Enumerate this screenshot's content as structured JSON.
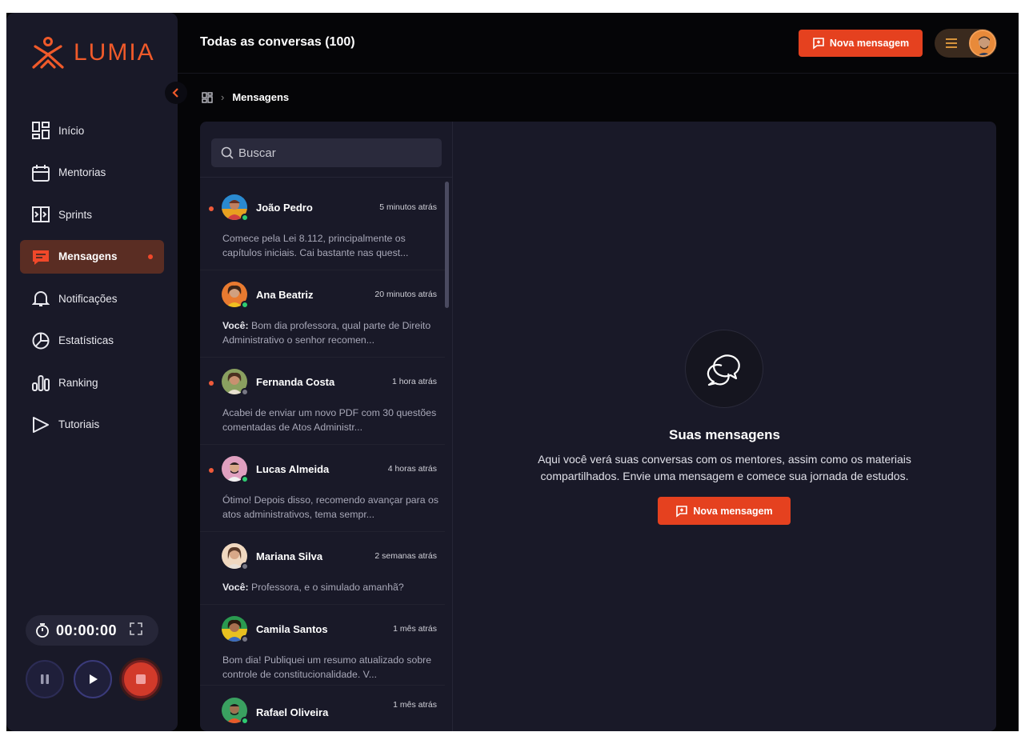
{
  "brand": {
    "name": "LUMIA",
    "accent": "#e5411f"
  },
  "sidebar": {
    "items": [
      {
        "label": "Início",
        "icon": "dashboard-icon"
      },
      {
        "label": "Mentorias",
        "icon": "calendar-icon"
      },
      {
        "label": "Sprints",
        "icon": "sprints-icon"
      },
      {
        "label": "Mensagens",
        "icon": "message-icon",
        "active": true
      },
      {
        "label": "Notificações",
        "icon": "bell-icon"
      },
      {
        "label": "Estatísticas",
        "icon": "pie-chart-icon"
      },
      {
        "label": "Ranking",
        "icon": "bar-chart-icon"
      },
      {
        "label": "Tutoriais",
        "icon": "play-icon"
      }
    ],
    "timer": "00:00:00"
  },
  "header": {
    "title": "Todas as conversas (100)",
    "new_message": "Nova mensagem"
  },
  "breadcrumb": {
    "current": "Mensagens"
  },
  "search": {
    "placeholder": "Buscar"
  },
  "conversations": [
    {
      "name": "João Pedro",
      "time": "5 minutos atrás",
      "prefix": "",
      "preview": "Comece pela Lei 8.112, principalmente os capítulos iniciais. Cai bastante nas quest...",
      "unread": true,
      "online": true
    },
    {
      "name": "Ana Beatriz",
      "time": "20 minutos atrás",
      "prefix": "Você:",
      "preview": " Bom dia professora, qual parte de Direito Administrativo o senhor recomen...",
      "unread": false,
      "online": true
    },
    {
      "name": "Fernanda Costa",
      "time": "1 hora atrás",
      "prefix": "",
      "preview": "Acabei de enviar um novo PDF com 30 questões comentadas de Atos Administr...",
      "unread": true,
      "online": false
    },
    {
      "name": "Lucas Almeida",
      "time": "4 horas atrás",
      "prefix": "",
      "preview": "Ótimo! Depois disso, recomendo avançar para os atos administrativos, tema sempr...",
      "unread": true,
      "online": true
    },
    {
      "name": "Mariana Silva",
      "time": "2 semanas atrás",
      "prefix": "Você:",
      "preview": " Professora, e o simulado amanhã?",
      "unread": false,
      "online": false
    },
    {
      "name": "Camila Santos",
      "time": "1 mês atrás",
      "prefix": "",
      "preview": "Bom dia! Publiquei um resumo atualizado sobre controle de constitucionalidade. V...",
      "unread": false,
      "online": false
    },
    {
      "name": "Rafael Oliveira",
      "time": "1 mês atrás",
      "prefix": "",
      "preview": "",
      "unread": false,
      "online": true
    }
  ],
  "empty_state": {
    "title": "Suas mensagens",
    "description": "Aqui você verá suas conversas com os mentores, assim como os materiais compartilhados. Envie uma mensagem e comece sua jornada de estudos.",
    "button": "Nova mensagem"
  }
}
